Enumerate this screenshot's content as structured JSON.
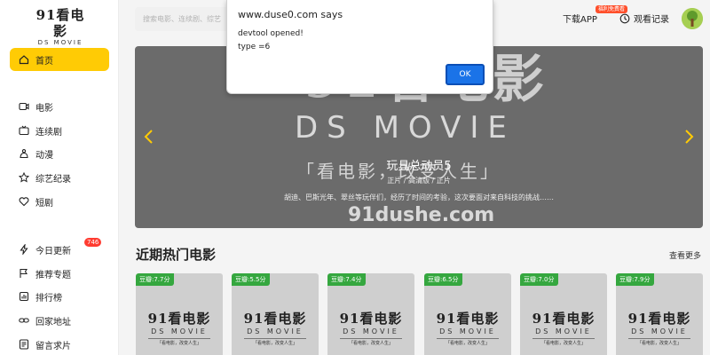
{
  "logo": {
    "main": "91看电影",
    "sub": "DS MOVIE"
  },
  "sidebar": {
    "home": "首页",
    "items": [
      {
        "label": "电影",
        "icon": "film-icon"
      },
      {
        "label": "连续剧",
        "icon": "tv-icon"
      },
      {
        "label": "动漫",
        "icon": "anime-icon"
      },
      {
        "label": "综艺纪录",
        "icon": "variety-icon"
      },
      {
        "label": "短剧",
        "icon": "heart-icon"
      },
      {
        "label": "今日更新",
        "icon": "flash-icon",
        "badge": "746"
      },
      {
        "label": "推荐专题",
        "icon": "flag-icon"
      },
      {
        "label": "排行榜",
        "icon": "rank-icon"
      },
      {
        "label": "回家地址",
        "icon": "link-icon"
      },
      {
        "label": "留言求片",
        "icon": "message-icon"
      }
    ]
  },
  "header": {
    "search_placeholder": "搜索电影、连续剧、综艺",
    "download_label": "下载APP",
    "download_badge": "福利免费看",
    "history_label": "观看记录"
  },
  "banner": {
    "title": "玩具总动员5",
    "meta": "正片 / 高清版 / 正片",
    "description": "胡迪、巴斯光年、翠丝等玩伴们，经历了时间的考验，这次要面对来自科技的挑战……",
    "bg_logo": "91看电影",
    "bg_ds": "DS MOVIE",
    "bg_slogan": "「看电影，改变人生」",
    "bg_url": "91dushe.com"
  },
  "section": {
    "title": "近期热门电影",
    "more": "查看更多",
    "cards": [
      {
        "score": "豆瓣:7.7分"
      },
      {
        "score": "豆瓣:5.5分"
      },
      {
        "score": "豆瓣:7.4分"
      },
      {
        "score": "豆瓣:6.5分"
      },
      {
        "score": "豆瓣:7.0分"
      },
      {
        "score": "豆瓣:7.9分"
      }
    ],
    "card_logo": "91看电影",
    "card_ds": "DS MOVIE",
    "card_slogan": "「看电影，改变人生」"
  },
  "dialog": {
    "header": "www.duse0.com says",
    "line1": "devtool opened!",
    "line2": "type =6",
    "ok_label": "OK"
  },
  "colors": {
    "accent": "#ffcb05",
    "score_green": "#35a73f",
    "ok_blue": "#1a73e8",
    "badge_red": "#ff3b30"
  }
}
